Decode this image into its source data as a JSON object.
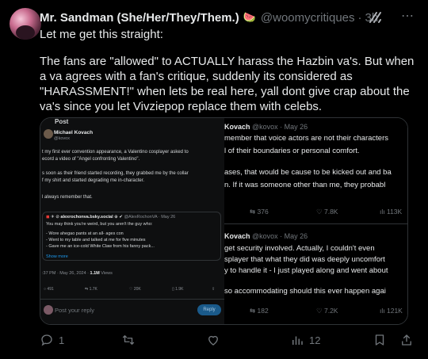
{
  "author": {
    "name": "Mr. Sandman (She/Her/They/Them.)",
    "emoji": "🍉",
    "handle": "@woomycritiques",
    "dot": "·",
    "time": "3h"
  },
  "tweet": {
    "line1": "Let me get this straight:",
    "line2": "The fans are \"allowed\" to ACTUALLY harass the Hazbin va's. But when a va agrees with a fan's critique, suddenly its considered as \"HARASSMENT!\" when lets be real here, yall dont give crap about the va's since you let Vivziepop replace them with celebs."
  },
  "media_left": {
    "post_label": "Post",
    "name": "Michael Kovach",
    "handle": "@kovox",
    "lines": [
      "t my first ever convention appearance, a Valentino cosplayer asked to",
      "ecord a video of \"Angel confronting Valentino\".",
      "s soon as their friend started recording, they grabbed me by the collar",
      "f my shirt and started degrading me in-character.",
      "l always remember that."
    ],
    "quote": {
      "name": "alexrochonva.bsky.social",
      "handle": "@AlexRochonVA · May 26",
      "lines": [
        "You may think you're weird, but you aren't the guy who:",
        "- Wore ahegao pants at an all- ages con",
        "- Went to my table and talked at me for five minutes",
        "- Gave me an ice-cold White Claw from his fanny pack..."
      ],
      "show_more": "Show more"
    },
    "meta_time": ":37 PM · May 26, 2024 · ",
    "meta_views": "1.1M",
    "meta_views_label": " Views",
    "actions": [
      "491",
      "1.7K",
      "20K",
      "1.9K"
    ],
    "reply_placeholder": "Post your reply",
    "reply_button": "Reply"
  },
  "media_right": {
    "reply1": {
      "author": "Kovach",
      "handle_time": "@kovox · May 26",
      "lines": [
        "member that voice actors are not their characters",
        "l of their boundaries or personal comfort.",
        "ases, that would be cause to be kicked out and ba",
        "n. If it was someone other than me, they probabl"
      ],
      "retweets": "376",
      "likes": "7.8K",
      "views": "113K"
    },
    "reply2": {
      "author": "Kovach",
      "handle_time": "@kovox · May 26",
      "lines": [
        "get security involved. Actually, I couldn't even",
        "splayer that what they did was deeply uncomfort",
        "y to handle it - I just played along and went about",
        "so accommodating should this ever happen agai"
      ],
      "retweets": "182",
      "likes": "7.2K",
      "views": "121K"
    }
  },
  "actions": {
    "replies": "1",
    "reposts": "",
    "likes": "",
    "views": "12"
  },
  "colors": {
    "muted": "#71767b",
    "text": "#e7e9ea",
    "link": "#1d9bf0"
  }
}
